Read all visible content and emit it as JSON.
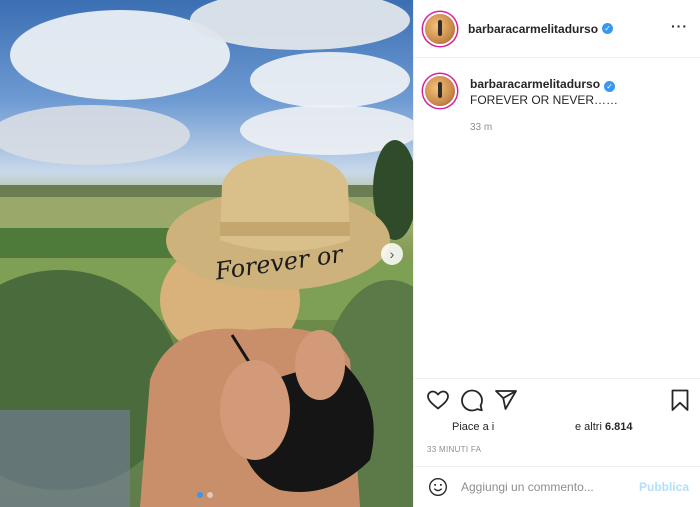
{
  "post": {
    "username": "barbaracarmelitadurso",
    "caption_text": "FOREVER OR NEVER……",
    "caption_time": "33 m",
    "hat_text": "Forever or",
    "likes_prefix": "Piace a",
    "likes_user": "i",
    "likes_suffix": "e altri",
    "likes_count": "6.814",
    "posted_ago": "33 MINUTI FA",
    "carousel_count": 2,
    "carousel_index": 1
  },
  "comment": {
    "placeholder": "Aggiungi un commento...",
    "post_label": "Pubblica"
  },
  "icons": {
    "verified": "verified-badge-icon",
    "more": "more-options-icon",
    "like": "heart-icon",
    "comment": "comment-icon",
    "share": "send-icon",
    "save": "bookmark-icon",
    "emoji": "emoji-icon",
    "next": "chevron-right-icon"
  },
  "colors": {
    "accent": "#3897f0",
    "post_button_disabled": "#b2dffc",
    "secondary_text": "#8e8e8e"
  }
}
